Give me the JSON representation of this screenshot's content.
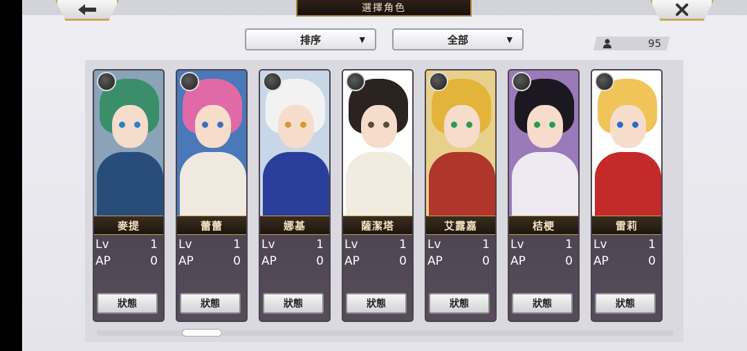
{
  "header": {
    "back_icon": "left-arrow-icon",
    "close_icon": "close-x-icon",
    "title": "選擇角色"
  },
  "filters": {
    "sort_label": "排序",
    "filter_label": "全部",
    "arrow_glyph": "▼"
  },
  "character_count": "95",
  "stat_labels": {
    "level": "Lv",
    "ap": "AP"
  },
  "status_button_label": "狀態",
  "characters": [
    {
      "name": "麥提",
      "lv": "1",
      "ap": "0",
      "hair": "#3a8f6a",
      "body": "#294d7a",
      "bg": "#8aa3b8",
      "eye": "#2b80c8"
    },
    {
      "name": "蕾蕾",
      "lv": "1",
      "ap": "0",
      "hair": "#e06aa8",
      "body": "#f0e9df",
      "bg": "#4a78b8",
      "eye": "#3a6fc0"
    },
    {
      "name": "娜基",
      "lv": "1",
      "ap": "0",
      "hair": "#f2f2f2",
      "body": "#2a3f9a",
      "bg": "#c8d6e8",
      "eye": "#d69a2a"
    },
    {
      "name": "薩潔塔",
      "lv": "1",
      "ap": "0",
      "hair": "#2a231f",
      "body": "#f1ece0",
      "bg": "#ffffff",
      "eye": "#5a4a3a"
    },
    {
      "name": "艾露嘉",
      "lv": "1",
      "ap": "0",
      "hair": "#e3b43a",
      "body": "#b0352a",
      "bg": "#e9d08a",
      "eye": "#2a9a52"
    },
    {
      "name": "桔梗",
      "lv": "1",
      "ap": "0",
      "hair": "#1b1822",
      "body": "#efeaf2",
      "bg": "#9a7ab8",
      "eye": "#2a9a52"
    },
    {
      "name": "雷莉",
      "lv": "1",
      "ap": "0",
      "hair": "#f0c458",
      "body": "#c42a2a",
      "bg": "#ffffff",
      "eye": "#2a6ac8"
    }
  ]
}
